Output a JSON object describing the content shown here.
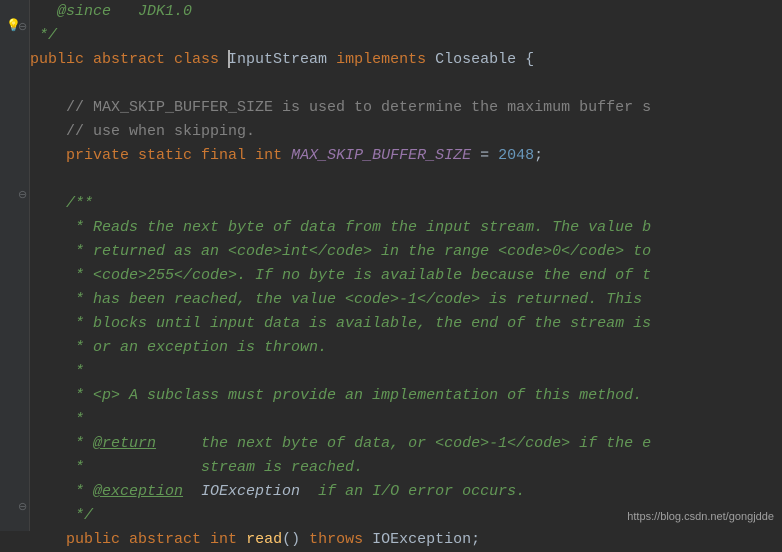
{
  "gutter": {
    "bulb_icon": "bulb-icon"
  },
  "code": {
    "l0": "   @since   JDK1.0",
    "l1_a": " */",
    "l2_public": "public ",
    "l2_abstract": "abstract ",
    "l2_class": "class ",
    "l2_name": "InputStream ",
    "l2_impl": "implements ",
    "l2_close": "Closeable ",
    "l2_brace": "{",
    "blank": "",
    "l4": "    // MAX_SKIP_BUFFER_SIZE is used to determine the maximum buffer s",
    "l5": "    // use when skipping.",
    "l6_private": "    private ",
    "l6_static": "static ",
    "l6_final": "final ",
    "l6_int": "int ",
    "l6_field": "MAX_SKIP_BUFFER_SIZE",
    "l6_eq": " = ",
    "l6_num": "2048",
    "l6_semi": ";",
    "l8": "    /**",
    "l9": "     * Reads the next byte of data from the input stream. The value b",
    "l10": "     * returned as an <code>int</code> in the range <code>0</code> to",
    "l11": "     * <code>255</code>. If no byte is available because the end of t",
    "l12": "     * has been reached, the value <code>-1</code> is returned. This ",
    "l13": "     * blocks until input data is available, the end of the stream is",
    "l14": "     * or an exception is thrown.",
    "l15": "     *",
    "l16": "     * <p> A subclass must provide an implementation of this method.",
    "l17": "     *",
    "l18_pre": "     * ",
    "l18_tag": "@return",
    "l18_post": "     the next byte of data, or <code>-1</code> if the e",
    "l19": "     *             stream is reached.",
    "l20_pre": "     * ",
    "l20_tag": "@exception",
    "l20_exc": "  IOException",
    "l20_post": "  if an I/O error occurs.",
    "l21": "     */",
    "l22_public": "    public ",
    "l22_abstract": "abstract ",
    "l22_int": "int ",
    "l22_method": "read",
    "l22_paren": "() ",
    "l22_throws": "throws ",
    "l22_exc": "IOException",
    "l22_semi": ";"
  },
  "watermark": "https://blog.csdn.net/gongjdde"
}
